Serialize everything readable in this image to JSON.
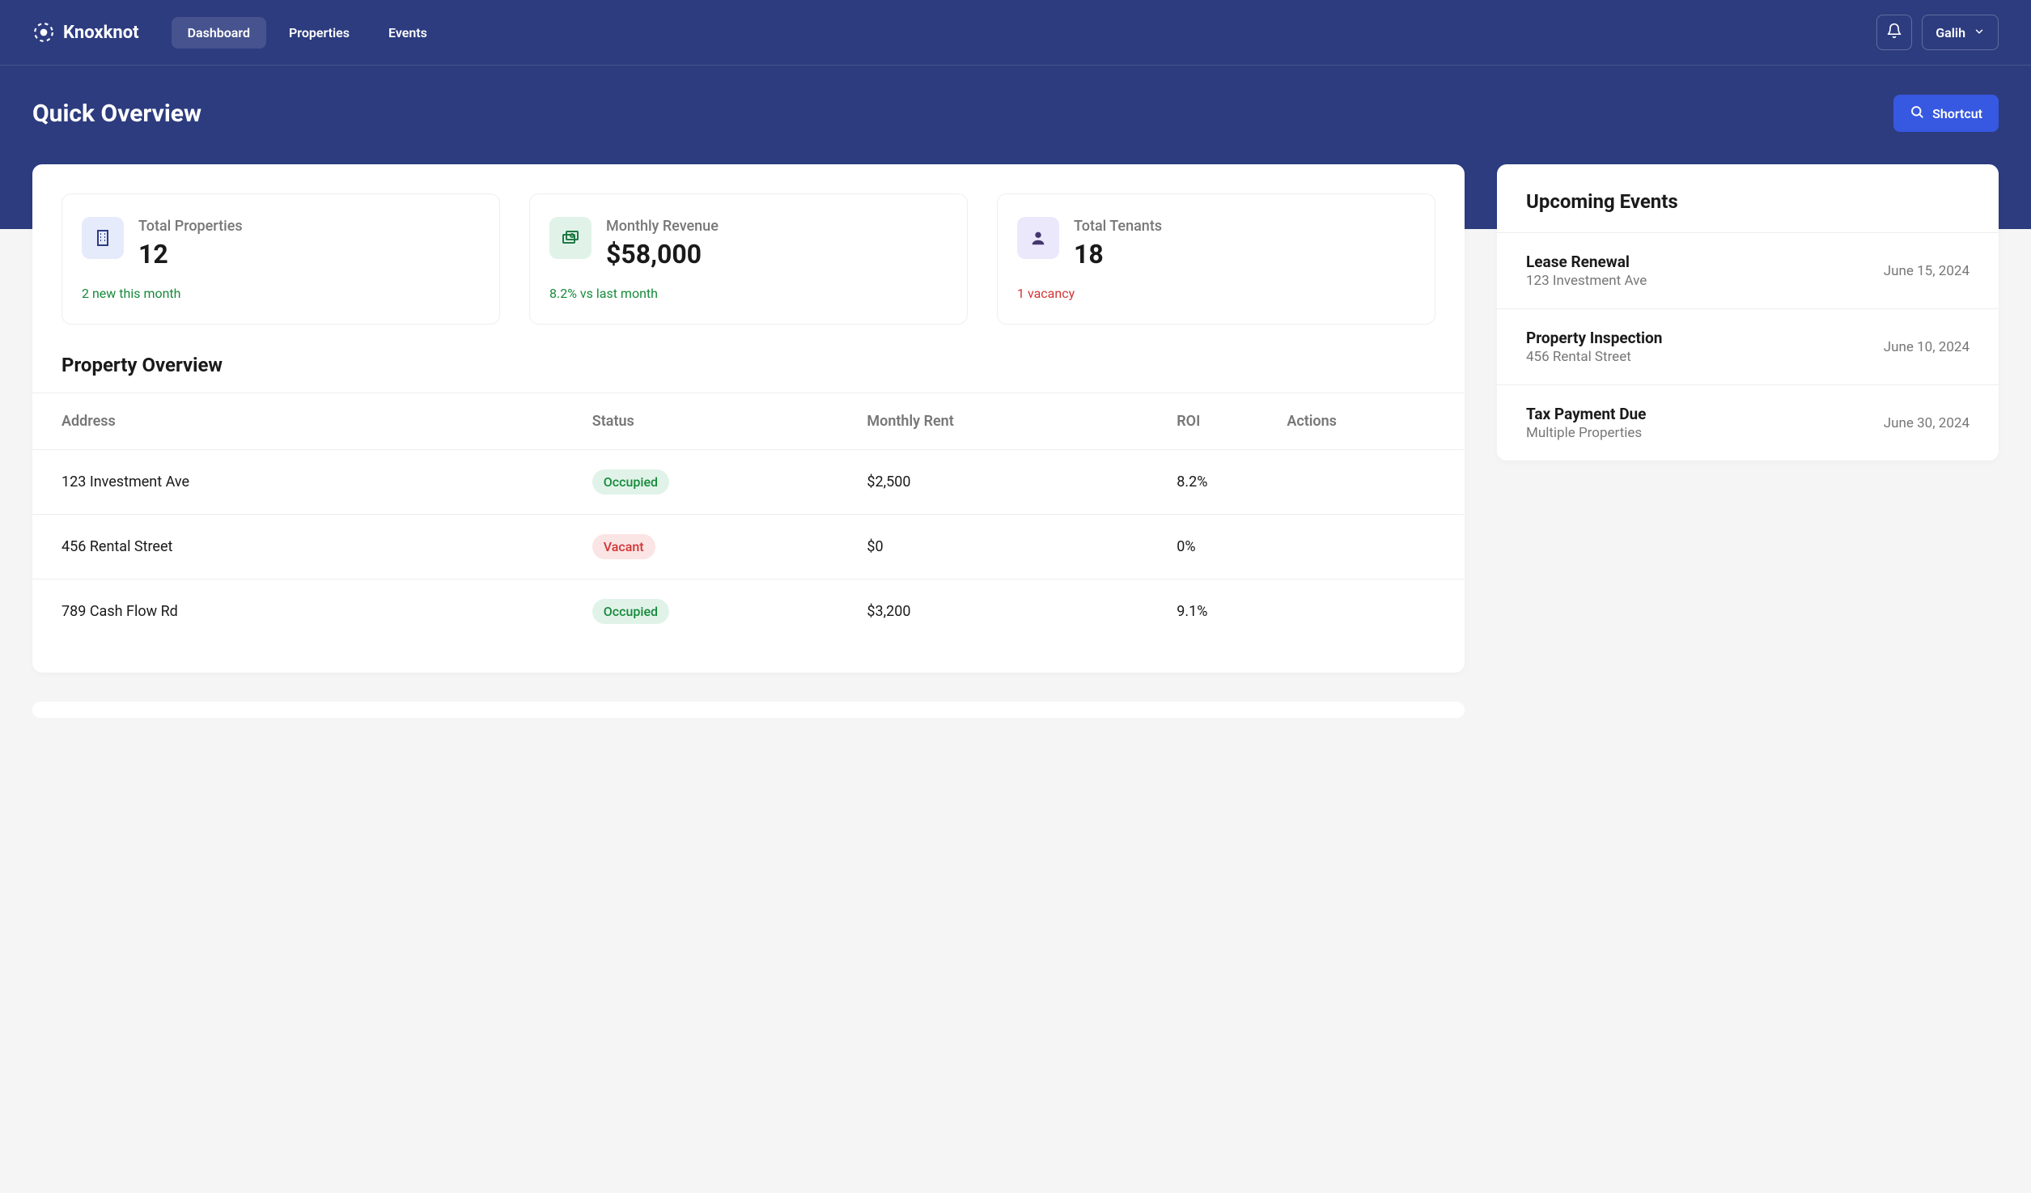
{
  "app": {
    "name": "Knoxknot"
  },
  "nav": {
    "tabs": [
      {
        "label": "Dashboard",
        "active": true
      },
      {
        "label": "Properties",
        "active": false
      },
      {
        "label": "Events",
        "active": false
      }
    ],
    "user": "Galih"
  },
  "page": {
    "title": "Quick Overview",
    "shortcut_label": "Shortcut"
  },
  "stats": [
    {
      "icon": "building-icon",
      "tone": "blue",
      "label": "Total Properties",
      "value": "12",
      "sub": "2 new this month",
      "sub_tone": "green"
    },
    {
      "icon": "money-icon",
      "tone": "green",
      "label": "Monthly Revenue",
      "value": "$58,000",
      "sub": "8.2% vs last month",
      "sub_tone": "green"
    },
    {
      "icon": "person-icon",
      "tone": "purple",
      "label": "Total Tenants",
      "value": "18",
      "sub": "1 vacancy",
      "sub_tone": "red"
    }
  ],
  "table": {
    "title": "Property Overview",
    "headers": [
      "Address",
      "Status",
      "Monthly Rent",
      "ROI",
      "Actions"
    ],
    "rows": [
      {
        "address": "123 Investment Ave",
        "status": "Occupied",
        "rent": "$2,500",
        "roi": "8.2%"
      },
      {
        "address": "456 Rental Street",
        "status": "Vacant",
        "rent": "$0",
        "roi": "0%"
      },
      {
        "address": "789 Cash Flow Rd",
        "status": "Occupied",
        "rent": "$3,200",
        "roi": "9.1%"
      }
    ]
  },
  "events": {
    "title": "Upcoming Events",
    "items": [
      {
        "name": "Lease Renewal",
        "sub": "123 Investment Ave",
        "date": "June 15, 2024"
      },
      {
        "name": "Property Inspection",
        "sub": "456 Rental Street",
        "date": "June 10, 2024"
      },
      {
        "name": "Tax Payment Due",
        "sub": "Multiple Properties",
        "date": "June 30, 2024"
      }
    ]
  }
}
